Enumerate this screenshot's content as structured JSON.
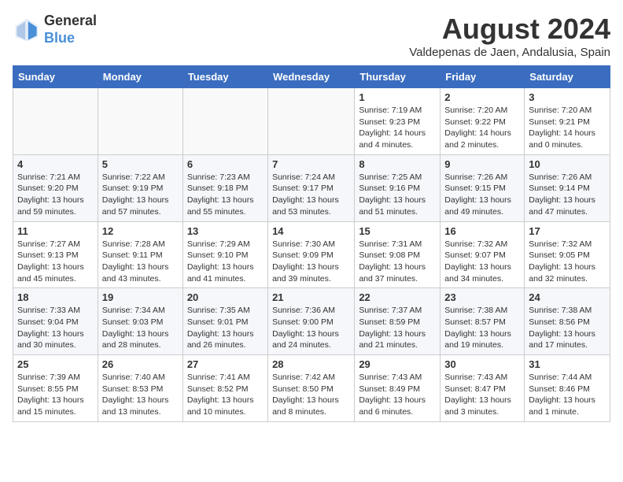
{
  "header": {
    "logo_line1": "General",
    "logo_line2": "Blue",
    "month_year": "August 2024",
    "location": "Valdepenas de Jaen, Andalusia, Spain"
  },
  "weekdays": [
    "Sunday",
    "Monday",
    "Tuesday",
    "Wednesday",
    "Thursday",
    "Friday",
    "Saturday"
  ],
  "weeks": [
    [
      {
        "day": "",
        "info": ""
      },
      {
        "day": "",
        "info": ""
      },
      {
        "day": "",
        "info": ""
      },
      {
        "day": "",
        "info": ""
      },
      {
        "day": "1",
        "info": "Sunrise: 7:19 AM\nSunset: 9:23 PM\nDaylight: 14 hours\nand 4 minutes."
      },
      {
        "day": "2",
        "info": "Sunrise: 7:20 AM\nSunset: 9:22 PM\nDaylight: 14 hours\nand 2 minutes."
      },
      {
        "day": "3",
        "info": "Sunrise: 7:20 AM\nSunset: 9:21 PM\nDaylight: 14 hours\nand 0 minutes."
      }
    ],
    [
      {
        "day": "4",
        "info": "Sunrise: 7:21 AM\nSunset: 9:20 PM\nDaylight: 13 hours\nand 59 minutes."
      },
      {
        "day": "5",
        "info": "Sunrise: 7:22 AM\nSunset: 9:19 PM\nDaylight: 13 hours\nand 57 minutes."
      },
      {
        "day": "6",
        "info": "Sunrise: 7:23 AM\nSunset: 9:18 PM\nDaylight: 13 hours\nand 55 minutes."
      },
      {
        "day": "7",
        "info": "Sunrise: 7:24 AM\nSunset: 9:17 PM\nDaylight: 13 hours\nand 53 minutes."
      },
      {
        "day": "8",
        "info": "Sunrise: 7:25 AM\nSunset: 9:16 PM\nDaylight: 13 hours\nand 51 minutes."
      },
      {
        "day": "9",
        "info": "Sunrise: 7:26 AM\nSunset: 9:15 PM\nDaylight: 13 hours\nand 49 minutes."
      },
      {
        "day": "10",
        "info": "Sunrise: 7:26 AM\nSunset: 9:14 PM\nDaylight: 13 hours\nand 47 minutes."
      }
    ],
    [
      {
        "day": "11",
        "info": "Sunrise: 7:27 AM\nSunset: 9:13 PM\nDaylight: 13 hours\nand 45 minutes."
      },
      {
        "day": "12",
        "info": "Sunrise: 7:28 AM\nSunset: 9:11 PM\nDaylight: 13 hours\nand 43 minutes."
      },
      {
        "day": "13",
        "info": "Sunrise: 7:29 AM\nSunset: 9:10 PM\nDaylight: 13 hours\nand 41 minutes."
      },
      {
        "day": "14",
        "info": "Sunrise: 7:30 AM\nSunset: 9:09 PM\nDaylight: 13 hours\nand 39 minutes."
      },
      {
        "day": "15",
        "info": "Sunrise: 7:31 AM\nSunset: 9:08 PM\nDaylight: 13 hours\nand 37 minutes."
      },
      {
        "day": "16",
        "info": "Sunrise: 7:32 AM\nSunset: 9:07 PM\nDaylight: 13 hours\nand 34 minutes."
      },
      {
        "day": "17",
        "info": "Sunrise: 7:32 AM\nSunset: 9:05 PM\nDaylight: 13 hours\nand 32 minutes."
      }
    ],
    [
      {
        "day": "18",
        "info": "Sunrise: 7:33 AM\nSunset: 9:04 PM\nDaylight: 13 hours\nand 30 minutes."
      },
      {
        "day": "19",
        "info": "Sunrise: 7:34 AM\nSunset: 9:03 PM\nDaylight: 13 hours\nand 28 minutes."
      },
      {
        "day": "20",
        "info": "Sunrise: 7:35 AM\nSunset: 9:01 PM\nDaylight: 13 hours\nand 26 minutes."
      },
      {
        "day": "21",
        "info": "Sunrise: 7:36 AM\nSunset: 9:00 PM\nDaylight: 13 hours\nand 24 minutes."
      },
      {
        "day": "22",
        "info": "Sunrise: 7:37 AM\nSunset: 8:59 PM\nDaylight: 13 hours\nand 21 minutes."
      },
      {
        "day": "23",
        "info": "Sunrise: 7:38 AM\nSunset: 8:57 PM\nDaylight: 13 hours\nand 19 minutes."
      },
      {
        "day": "24",
        "info": "Sunrise: 7:38 AM\nSunset: 8:56 PM\nDaylight: 13 hours\nand 17 minutes."
      }
    ],
    [
      {
        "day": "25",
        "info": "Sunrise: 7:39 AM\nSunset: 8:55 PM\nDaylight: 13 hours\nand 15 minutes."
      },
      {
        "day": "26",
        "info": "Sunrise: 7:40 AM\nSunset: 8:53 PM\nDaylight: 13 hours\nand 13 minutes."
      },
      {
        "day": "27",
        "info": "Sunrise: 7:41 AM\nSunset: 8:52 PM\nDaylight: 13 hours\nand 10 minutes."
      },
      {
        "day": "28",
        "info": "Sunrise: 7:42 AM\nSunset: 8:50 PM\nDaylight: 13 hours\nand 8 minutes."
      },
      {
        "day": "29",
        "info": "Sunrise: 7:43 AM\nSunset: 8:49 PM\nDaylight: 13 hours\nand 6 minutes."
      },
      {
        "day": "30",
        "info": "Sunrise: 7:43 AM\nSunset: 8:47 PM\nDaylight: 13 hours\nand 3 minutes."
      },
      {
        "day": "31",
        "info": "Sunrise: 7:44 AM\nSunset: 8:46 PM\nDaylight: 13 hours\nand 1 minute."
      }
    ]
  ]
}
